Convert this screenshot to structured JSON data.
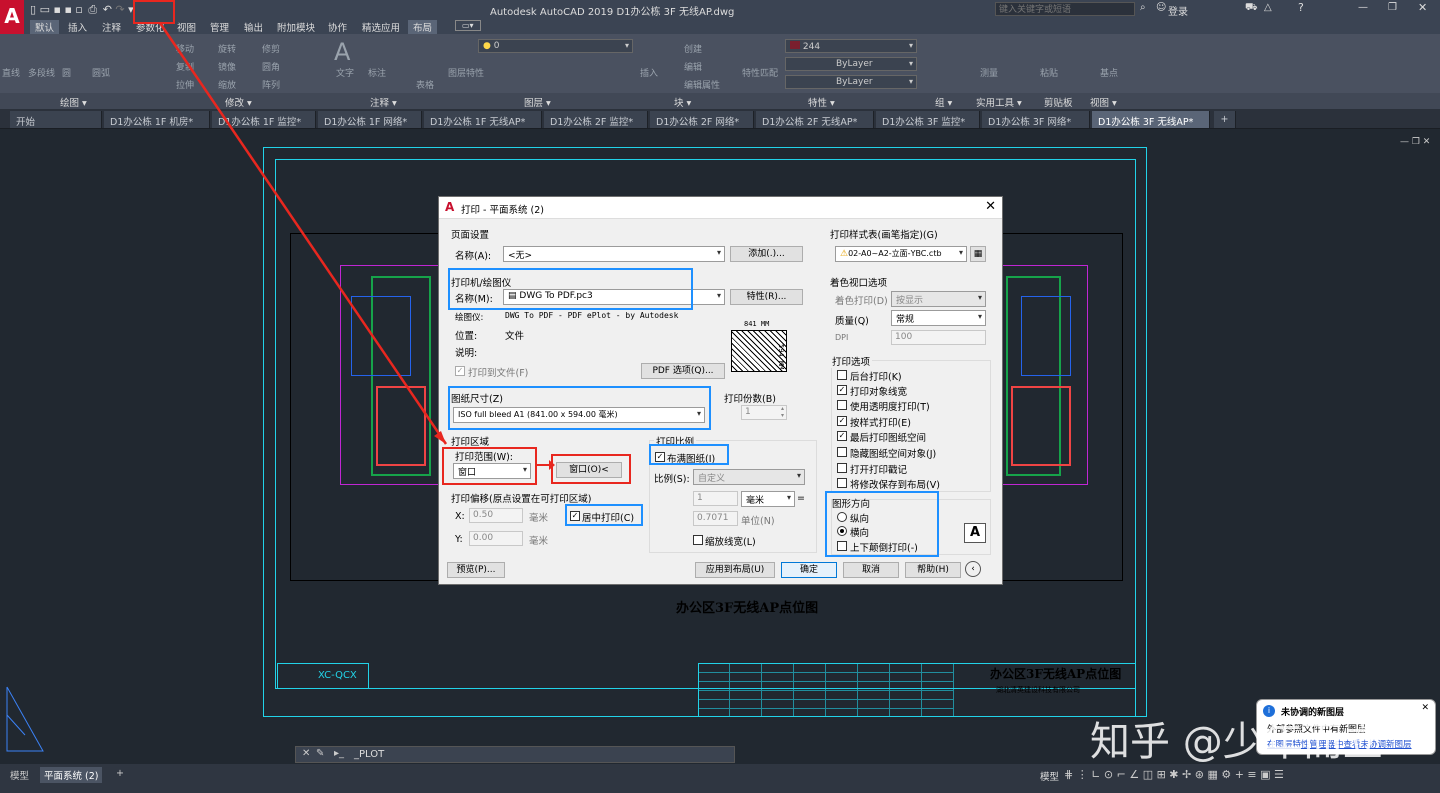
{
  "window": {
    "title": "Autodesk AutoCAD 2019    D1办公栋 3F 无线AP.dwg",
    "search_placeholder": "键入关键字或短语",
    "login": "登录"
  },
  "menu": [
    "默认",
    "插入",
    "注释",
    "参数化",
    "视图",
    "管理",
    "输出",
    "附加模块",
    "协作",
    "精选应用",
    "布局"
  ],
  "ribbon": {
    "panels": [
      "绘图 ▾",
      "修改 ▾",
      "注释 ▾",
      "图层 ▾",
      "块 ▾",
      "特性 ▾",
      "组 ▾",
      "实用工具 ▾",
      "剪贴板",
      "视图 ▾"
    ],
    "tools": [
      "直线",
      "多段线",
      "圆",
      "圆弧",
      "移动",
      "旋转",
      "修剪",
      "复制",
      "镜像",
      "圆角",
      "拉伸",
      "缩放",
      "阵列",
      "文字",
      "标注",
      "表格",
      "图层特性",
      "插入",
      "创建",
      "编辑",
      "编辑属性",
      "特性匹配",
      "测量",
      "粘贴",
      "基点"
    ],
    "layer_value": "0",
    "color_value": "244",
    "bylayer1": "ByLayer",
    "bylayer2": "ByLayer"
  },
  "doc_tabs": [
    "开始",
    "D1办公栋 1F 机房*",
    "D1办公栋 1F 监控*",
    "D1办公栋 1F 网络*",
    "D1办公栋 1F 无线AP*",
    "D1办公栋 2F 监控*",
    "D1办公栋 2F 网络*",
    "D1办公栋 2F 无线AP*",
    "D1办公栋 3F 监控*",
    "D1办公栋 3F 网络*",
    "D1办公栋 3F 无线AP*"
  ],
  "drawing": {
    "title": "办公区3F无线AP点位图",
    "tb_title": "办公区3F无线AP点位图",
    "tb_company": "湖北清英建设科技有限公司",
    "tb_code": "XC-QCX"
  },
  "dialog": {
    "title": "打印 - 平面系统 (2)",
    "page_setup": {
      "section": "页面设置",
      "name_label": "名称(A):",
      "name_value": "<无>",
      "add_button": "添加(.)..."
    },
    "printer": {
      "section": "打印机/绘图仪",
      "name_label": "名称(M):",
      "name_value": "DWG To PDF.pc3",
      "props_button": "特性(R)...",
      "plotter_label": "绘图仪:",
      "plotter_value": "DWG To PDF - PDF ePlot - by Autodesk",
      "where_label": "位置:",
      "where_value": "文件",
      "desc_label": "说明:",
      "print_to_file": "打印到文件(F)",
      "pdf_options": "PDF 选项(Q)...",
      "preview_w": "841 MM",
      "preview_h": "594 MM"
    },
    "paper": {
      "section": "图纸尺寸(Z)",
      "value": "ISO full bleed A1 (841.00 x 594.00 毫米)"
    },
    "copies": {
      "label": "打印份数(B)",
      "value": "1"
    },
    "area": {
      "section": "打印区域",
      "range_label": "打印范围(W):",
      "range_value": "窗口",
      "window_button": "窗口(O)<"
    },
    "offset": {
      "section": "打印偏移(原点设置在可打印区域)",
      "x_label": "X:",
      "x_value": "0.50",
      "y_label": "Y:",
      "y_value": "0.00",
      "unit": "毫米",
      "center": "居中打印(C)"
    },
    "scale": {
      "section": "打印比例",
      "fit": "布满图纸(I)",
      "ratio_label": "比例(S):",
      "ratio_value": "自定义",
      "v1": "1",
      "u1": "毫米",
      "v2": "0.7071",
      "u2": "单位(N)",
      "lineweights": "缩放线宽(L)"
    },
    "style_table": {
      "section": "打印样式表(画笔指定)(G)",
      "value": "02-A0~A2-立面-YBC.ctb"
    },
    "shaded": {
      "section": "着色视口选项",
      "shade_label": "着色打印(D)",
      "shade_value": "按显示",
      "quality_label": "质量(Q)",
      "quality_value": "常规",
      "dpi_label": "DPI",
      "dpi_value": "100"
    },
    "options": {
      "section": "打印选项",
      "items": [
        {
          "label": "后台打印(K)",
          "checked": false
        },
        {
          "label": "打印对象线宽",
          "checked": true
        },
        {
          "label": "使用透明度打印(T)",
          "checked": false
        },
        {
          "label": "按样式打印(E)",
          "checked": true
        },
        {
          "label": "最后打印图纸空间",
          "checked": true
        },
        {
          "label": "隐藏图纸空间对象(J)",
          "checked": false
        },
        {
          "label": "打开打印戳记",
          "checked": false
        },
        {
          "label": "将修改保存到布局(V)",
          "checked": false
        }
      ]
    },
    "orientation": {
      "section": "图形方向",
      "portrait": "纵向",
      "landscape": "横向",
      "upside": "上下颠倒打印(-)"
    },
    "buttons": {
      "preview": "预览(P)...",
      "apply": "应用到布局(U)",
      "ok": "确定",
      "cancel": "取消",
      "help": "帮助(H)"
    }
  },
  "notification": {
    "title": "未协调的新图层",
    "line1": "外部参照文件中有新图层",
    "link": "在图层特性管理器中查看未协调新图层"
  },
  "command": {
    "prompt": "_PLOT"
  },
  "status": {
    "tabs": [
      "模型",
      "平面系统 (2)"
    ],
    "model": "模型"
  },
  "watermark": "知乎 @少年而立"
}
